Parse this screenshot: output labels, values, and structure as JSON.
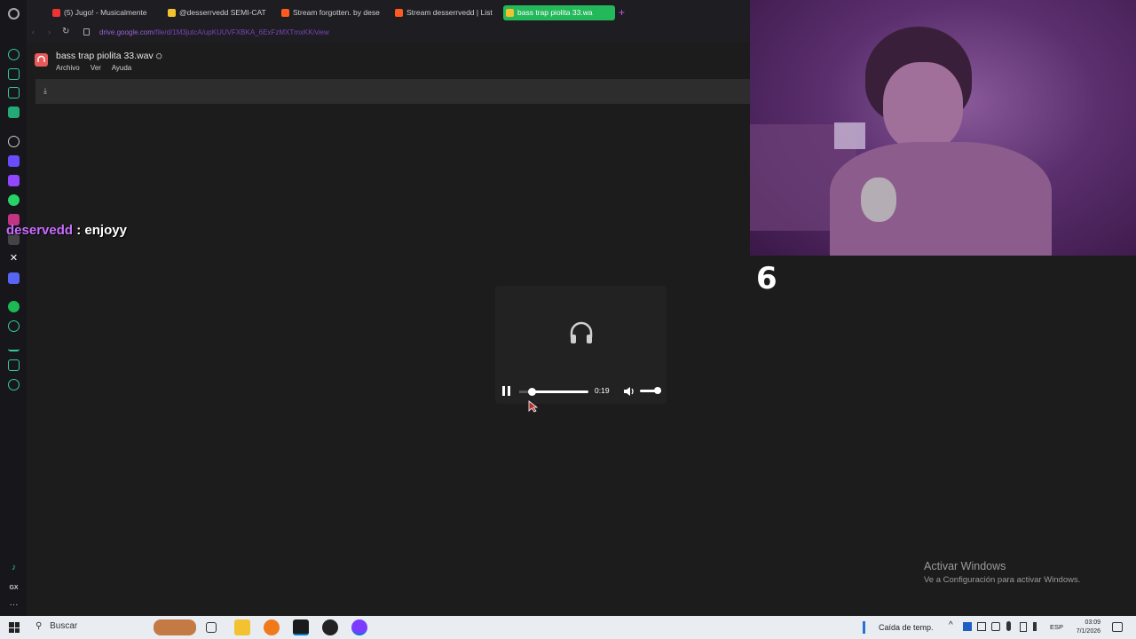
{
  "browser": {
    "tabs": [
      {
        "label": "(5) Jugo! - Musicalmente",
        "favicon": "youtube-icon",
        "color": "#e33"
      },
      {
        "label": "@desserrvedd SEMI-CAT",
        "favicon": "drive-icon",
        "color": "#f2c12e"
      },
      {
        "label": "Stream forgotten. by dese",
        "favicon": "soundcloud-icon",
        "color": "#ff5a1f"
      },
      {
        "label": "Stream desserrvedd | List",
        "favicon": "soundcloud-icon",
        "color": "#ff5a1f"
      },
      {
        "label": "bass trap piolita 33.wa",
        "favicon": "drive-icon",
        "color": "#f2c12e",
        "active": true
      }
    ],
    "new_tab_label": "+",
    "url_host": "drive.google.com",
    "url_path": "/file/d/1M3jutcA/upKUUVFXBKA_6ExFzMXTmxKK/view"
  },
  "drive": {
    "file_name": "bass trap piolita 33.wav",
    "menus": [
      "Archivo",
      "Ver",
      "Ayuda"
    ]
  },
  "chat": {
    "username": "deservedd",
    "separator": ":",
    "message": "enjoyy"
  },
  "player": {
    "time": "0:19",
    "progress": 0.18,
    "volume": 0.85
  },
  "overlay": {
    "counter": "6"
  },
  "watermark": {
    "title": "Activar Windows",
    "subtitle": "Ve a Configuración para activar Windows."
  },
  "taskbar": {
    "search_placeholder": "Buscar",
    "weather": "Caída de temp.",
    "language": "ESP",
    "time": "03:09",
    "date": "7/1/2026"
  }
}
